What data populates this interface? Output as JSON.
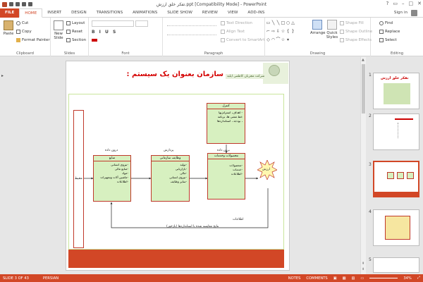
{
  "app": {
    "title": "تفکر خلق ارزش.ppt [Compatibility Mode] - PowerPoint",
    "sign_in": "Sign in",
    "window_controls": [
      "?",
      "▭",
      "–",
      "□",
      "✕"
    ]
  },
  "tabs": [
    "FILE",
    "HOME",
    "INSERT",
    "DESIGN",
    "TRANSITIONS",
    "ANIMATIONS",
    "SLIDE SHOW",
    "REVIEW",
    "VIEW",
    "ADD-INS"
  ],
  "ribbon": {
    "clipboard": {
      "paste": "Paste",
      "cut": "Cut",
      "copy": "Copy",
      "format_painter": "Format Painter",
      "label": "Clipboard"
    },
    "slides": {
      "new_slide": "New Slide",
      "layout": "Layout",
      "reset": "Reset",
      "section": "Section",
      "label": "Slides"
    },
    "font": {
      "label": "Font"
    },
    "paragraph": {
      "text_direction": "Text Direction",
      "align_text": "Align Text",
      "convert_smartart": "Convert to SmartArt",
      "label": "Paragraph"
    },
    "drawing": {
      "arrange": "Arrange",
      "quick_styles": "Quick Styles",
      "shape_fill": "Shape Fill",
      "shape_outline": "Shape Outline",
      "shape_effects": "Shape Effects",
      "label": "Drawing"
    },
    "editing": {
      "find": "Find",
      "replace": "Replace",
      "select": "Select",
      "label": "Editing"
    }
  },
  "slide": {
    "title": "سازمان بعنوان یک سیستم :",
    "company": "شرکت مجربان کاظمی اپلید",
    "environment": "محیط",
    "inputs_caption": "درون داده",
    "process_caption": "پردازش",
    "outputs_caption": "برون داده",
    "control": {
      "header": "کنترل",
      "items": [
        "- اهداف، استراتژیها",
        "خط مشی ها، برنامه",
        "، بودجه ، استانداردها"
      ]
    },
    "inputs": {
      "header": "منابع",
      "items": [
        "-نیروی انسانی",
        "-منابع مالی",
        "-مواد",
        "-ماشین آلات وتجهیزات",
        "-اطلاعات"
      ]
    },
    "process": {
      "header": "وظایف سازمانی",
      "items": [
        "-تولید",
        "-بازاریابی",
        "-مالی",
        "-نیروی انسانی",
        "-سایر وظایف"
      ]
    },
    "outputs": {
      "header": "محصولات وخدمات",
      "items": [
        "-محصولات",
        "-خدمات",
        "-اطلاعات"
      ]
    },
    "value": "ارزش",
    "feedback_label": "اطلاعات",
    "feedback_text": "نتایج مقایسه شده با استانداردها (بازخور)"
  },
  "thumbnails": [
    {
      "num": "1",
      "title": "تفکر خلق ارزش"
    },
    {
      "num": "2",
      "title": ""
    },
    {
      "num": "3",
      "title": ""
    },
    {
      "num": "4",
      "title": ""
    },
    {
      "num": "5",
      "title": ""
    }
  ],
  "status": {
    "slide": "SLIDE 3 OF 43",
    "language": "PERSIAN",
    "notes": "NOTES",
    "comments": "COMMENTS",
    "zoom": "34%"
  },
  "colors": {
    "accent": "#d24726",
    "box_fill": "#d7f0c0",
    "box_border": "#c0392b"
  }
}
